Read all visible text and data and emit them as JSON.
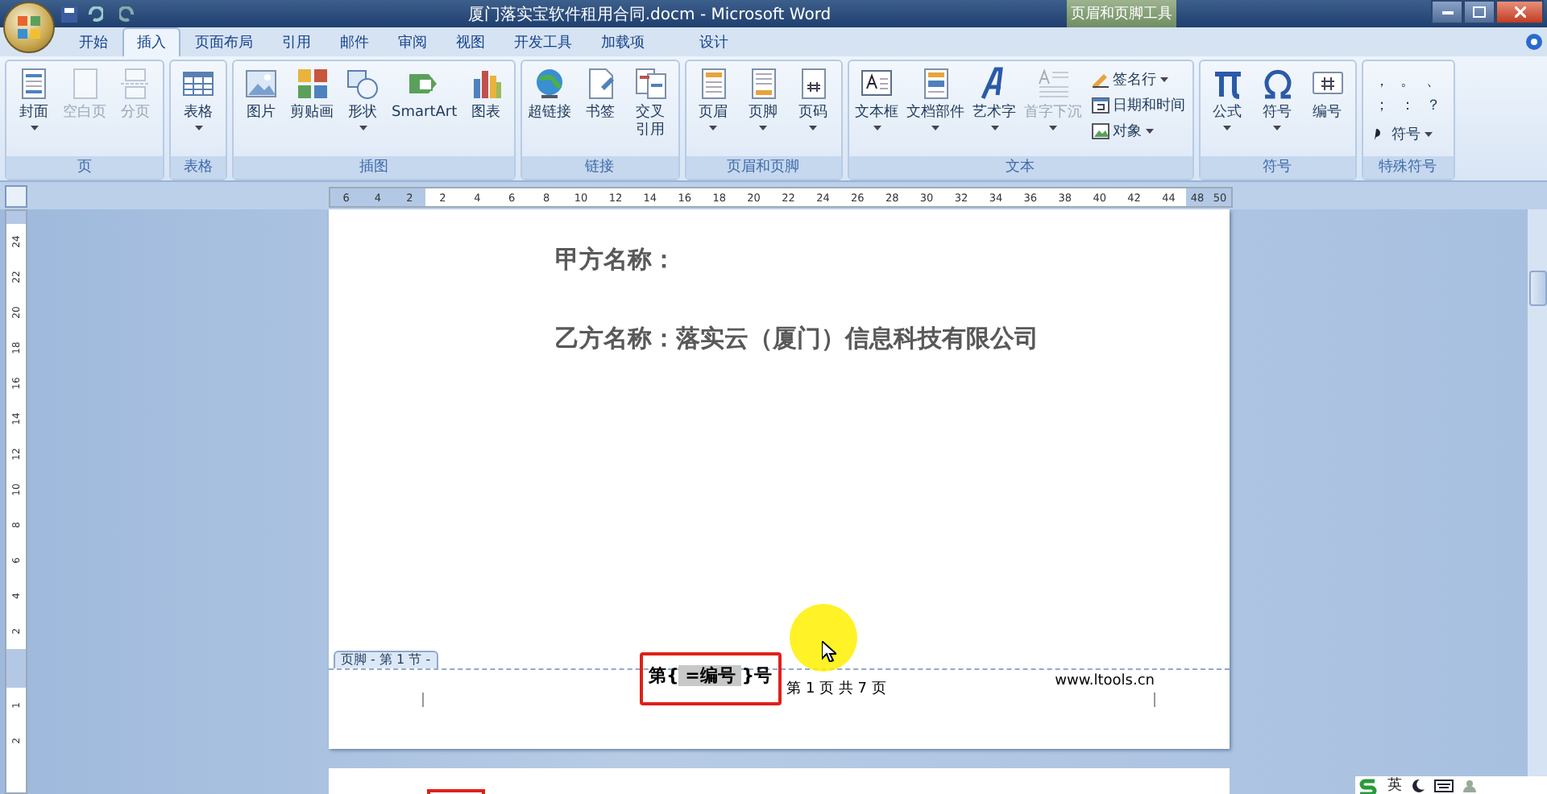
{
  "title_bar": {
    "title": "厦门落实宝软件租用合同.docm - Microsoft Word",
    "context_group": "页眉和页脚工具"
  },
  "tabs": [
    {
      "label": "开始",
      "selected": false,
      "kind": "normal"
    },
    {
      "label": "插入",
      "selected": true,
      "kind": "normal"
    },
    {
      "label": "页面布局",
      "selected": false,
      "kind": "normal"
    },
    {
      "label": "引用",
      "selected": false,
      "kind": "normal"
    },
    {
      "label": "邮件",
      "selected": false,
      "kind": "normal"
    },
    {
      "label": "审阅",
      "selected": false,
      "kind": "normal"
    },
    {
      "label": "视图",
      "selected": false,
      "kind": "normal"
    },
    {
      "label": "开发工具",
      "selected": false,
      "kind": "normal"
    },
    {
      "label": "加载项",
      "selected": false,
      "kind": "normal"
    },
    {
      "label": "设计",
      "selected": false,
      "kind": "context"
    }
  ],
  "ribbon": {
    "groups": [
      {
        "label": "页",
        "items": [
          {
            "kind": "large",
            "label": "封面",
            "dropdown": true,
            "disabled": false
          },
          {
            "kind": "large",
            "label": "空白页",
            "dropdown": false,
            "disabled": true
          },
          {
            "kind": "large",
            "label": "分页",
            "dropdown": false,
            "disabled": true
          }
        ]
      },
      {
        "label": "表格",
        "items": [
          {
            "kind": "large",
            "label": "表格",
            "dropdown": true,
            "disabled": false
          }
        ]
      },
      {
        "label": "插图",
        "items": [
          {
            "kind": "large",
            "label": "图片",
            "dropdown": false,
            "disabled": false
          },
          {
            "kind": "large",
            "label": "剪贴画",
            "dropdown": false,
            "disabled": false
          },
          {
            "kind": "large",
            "label": "形状",
            "dropdown": true,
            "disabled": false
          },
          {
            "kind": "large",
            "label": "SmartArt",
            "dropdown": false,
            "disabled": false
          },
          {
            "kind": "large",
            "label": "图表",
            "dropdown": false,
            "disabled": false
          }
        ]
      },
      {
        "label": "链接",
        "items": [
          {
            "kind": "large",
            "label": "超链接",
            "dropdown": false,
            "disabled": false
          },
          {
            "kind": "large",
            "label": "书签",
            "dropdown": false,
            "disabled": false
          },
          {
            "kind": "large",
            "label": "交叉引用",
            "dropdown": false,
            "disabled": false,
            "wrap": true
          }
        ]
      },
      {
        "label": "页眉和页脚",
        "items": [
          {
            "kind": "large",
            "label": "页眉",
            "dropdown": true,
            "disabled": false
          },
          {
            "kind": "large",
            "label": "页脚",
            "dropdown": true,
            "disabled": false
          },
          {
            "kind": "large",
            "label": "页码",
            "dropdown": true,
            "disabled": false
          }
        ]
      },
      {
        "label": "文本",
        "items": [
          {
            "kind": "large",
            "label": "文本框",
            "dropdown": true,
            "disabled": false
          },
          {
            "kind": "large",
            "label": "文档部件",
            "dropdown": true,
            "disabled": false
          },
          {
            "kind": "large",
            "label": "艺术字",
            "dropdown": true,
            "disabled": false
          },
          {
            "kind": "large",
            "label": "首字下沉",
            "dropdown": true,
            "disabled": true
          },
          {
            "kind": "small",
            "label": "签名行",
            "dropdown": true,
            "disabled": false
          },
          {
            "kind": "small",
            "label": "日期和时间",
            "dropdown": false,
            "disabled": false
          },
          {
            "kind": "small",
            "label": "对象",
            "dropdown": true,
            "disabled": false
          }
        ]
      },
      {
        "label": "符号",
        "items": [
          {
            "kind": "large",
            "label": "公式",
            "dropdown": true,
            "disabled": false
          },
          {
            "kind": "large",
            "label": "符号",
            "dropdown": true,
            "disabled": false
          },
          {
            "kind": "large",
            "label": "编号",
            "dropdown": false,
            "disabled": false
          }
        ]
      },
      {
        "label": "特殊符号",
        "items": [
          {
            "kind": "glyph",
            "label": "，"
          },
          {
            "kind": "glyph",
            "label": "。"
          },
          {
            "kind": "glyph",
            "label": "、"
          },
          {
            "kind": "glyph",
            "label": "；"
          },
          {
            "kind": "glyph",
            "label": "："
          },
          {
            "kind": "glyph",
            "label": "？"
          },
          {
            "kind": "small",
            "label": "符号",
            "dropdown": true,
            "disabled": false
          }
        ]
      }
    ]
  },
  "ruler": {
    "left_ticks": [
      "6",
      "4",
      "2"
    ],
    "ticks": [
      "2",
      "4",
      "6",
      "8",
      "10",
      "12",
      "14",
      "16",
      "18",
      "20",
      "22",
      "24",
      "26",
      "28",
      "30",
      "32",
      "34",
      "36",
      "38",
      "40",
      "42",
      "44"
    ],
    "right_ticks": [
      "48",
      "50"
    ]
  },
  "vertical_ruler": {
    "upper": [
      "24",
      "22",
      "20",
      "18",
      "16",
      "14",
      "12",
      "10",
      "8",
      "6",
      "4",
      "2"
    ],
    "lower": [
      "1",
      "2"
    ]
  },
  "document": {
    "lines": [
      "甲方名称：",
      "乙方名称：落实云（厦门）信息科技有限公司"
    ],
    "footer": {
      "tab_label": "页脚 - 第 1 节 -",
      "field_before": "第{",
      "field_code": " =编号 ",
      "field_after": "}号",
      "page_info": "第 1 页 共 7 页",
      "website": "www.ltools.cn"
    }
  },
  "ime_bar": {
    "mode": "英"
  }
}
